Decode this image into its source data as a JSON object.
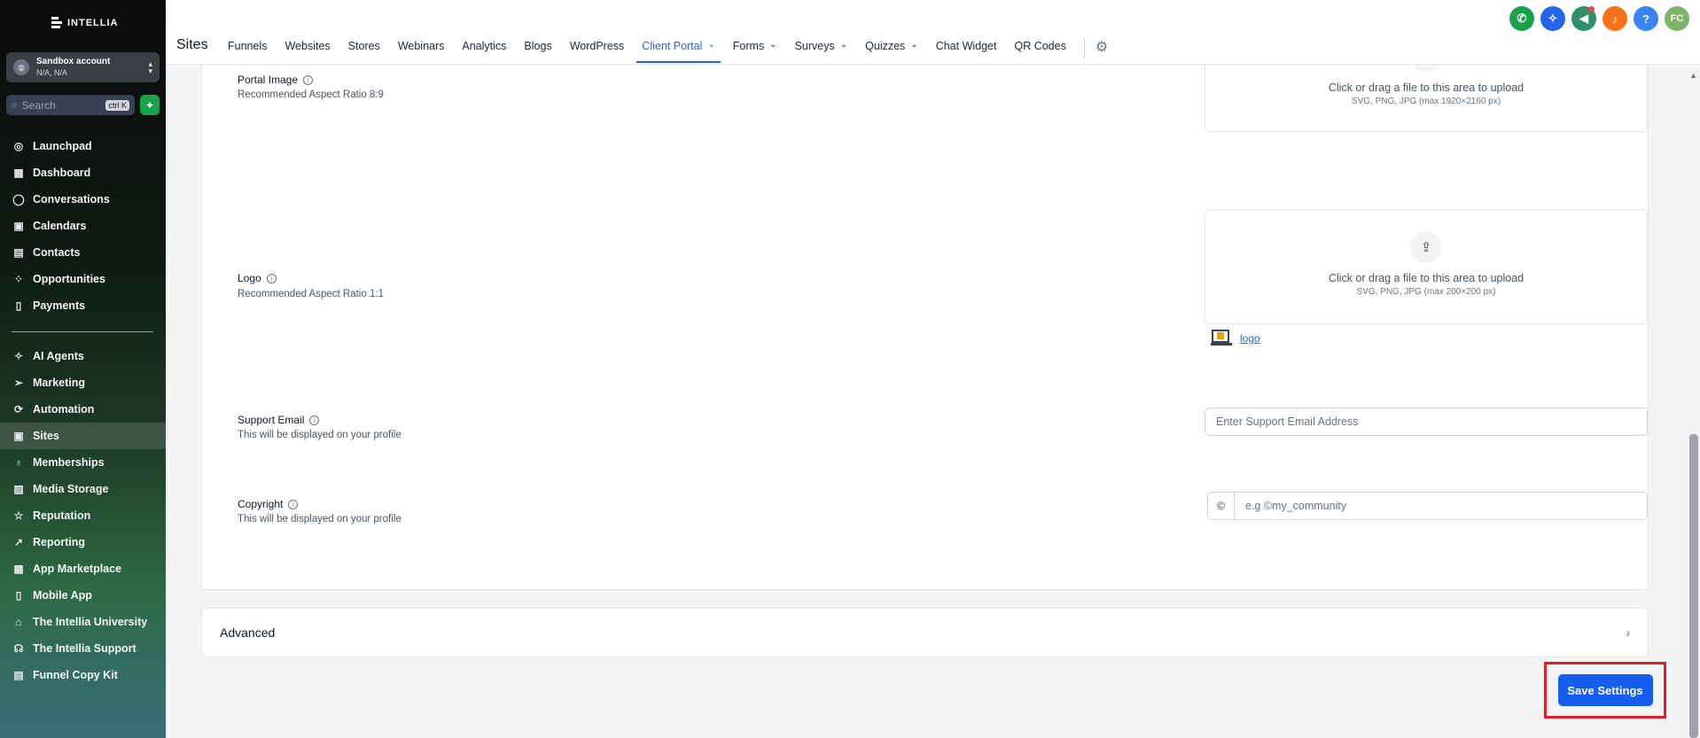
{
  "brand": {
    "name": "INTELLIA"
  },
  "account": {
    "name": "Sandbox account",
    "location": "N/A, N/A"
  },
  "search": {
    "placeholder": "Search",
    "shortcut": "ctrl K"
  },
  "sidebar": {
    "top_items": [
      {
        "label": "Launchpad",
        "icon": "launchpad-icon"
      },
      {
        "label": "Dashboard",
        "icon": "dashboard-icon"
      },
      {
        "label": "Conversations",
        "icon": "chat-icon"
      },
      {
        "label": "Calendars",
        "icon": "calendar-icon"
      },
      {
        "label": "Contacts",
        "icon": "contacts-icon"
      },
      {
        "label": "Opportunities",
        "icon": "opportunities-icon"
      },
      {
        "label": "Payments",
        "icon": "payments-icon"
      }
    ],
    "bottom_items": [
      {
        "label": "AI Agents",
        "icon": "ai-agents-icon"
      },
      {
        "label": "Marketing",
        "icon": "send-icon"
      },
      {
        "label": "Automation",
        "icon": "automation-icon"
      },
      {
        "label": "Sites",
        "icon": "sites-icon",
        "active": true
      },
      {
        "label": "Memberships",
        "icon": "badge-icon"
      },
      {
        "label": "Media Storage",
        "icon": "image-icon"
      },
      {
        "label": "Reputation",
        "icon": "star-icon"
      },
      {
        "label": "Reporting",
        "icon": "trend-icon"
      },
      {
        "label": "App Marketplace",
        "icon": "grid-icon"
      },
      {
        "label": "Mobile App",
        "icon": "phone-icon"
      },
      {
        "label": "The Intellia University",
        "icon": "graduation-icon"
      },
      {
        "label": "The Intellia Support",
        "icon": "support-icon"
      },
      {
        "label": "Funnel Copy Kit",
        "icon": "document-icon"
      }
    ]
  },
  "header": {
    "section_title": "Sites",
    "tabs": [
      {
        "label": "Funnels"
      },
      {
        "label": "Websites"
      },
      {
        "label": "Stores"
      },
      {
        "label": "Webinars"
      },
      {
        "label": "Analytics"
      },
      {
        "label": "Blogs"
      },
      {
        "label": "WordPress"
      },
      {
        "label": "Client Portal",
        "active": true,
        "dropdown": true
      },
      {
        "label": "Forms",
        "dropdown": true
      },
      {
        "label": "Surveys",
        "dropdown": true
      },
      {
        "label": "Quizzes",
        "dropdown": true
      },
      {
        "label": "Chat Widget"
      },
      {
        "label": "QR Codes"
      }
    ],
    "user_initials": "FC",
    "help_label": "?"
  },
  "form": {
    "portal_image": {
      "label": "Portal Image",
      "help": "Recommended Aspect Ratio 8:9",
      "upload_title": "Click or drag a file to this area to upload",
      "upload_sub": "SVG, PNG, JPG (max 1920×2160 px)"
    },
    "logo": {
      "label": "Logo",
      "help": "Recommended Aspect Ratio 1:1",
      "upload_title": "Click or drag a file to this area to upload",
      "upload_sub": "SVG, PNG, JPG (max 200×200 px)",
      "file_name": "logo"
    },
    "support_email": {
      "label": "Support Email",
      "help": "This will be displayed on your profile",
      "placeholder": "Enter Support Email Address"
    },
    "copyright": {
      "label": "Copyright",
      "help": "This will be displayed on your profile",
      "prefix": "©",
      "placeholder": "e.g ©my_community"
    }
  },
  "advanced": {
    "label": "Advanced"
  },
  "save": {
    "label": "Save Settings"
  }
}
